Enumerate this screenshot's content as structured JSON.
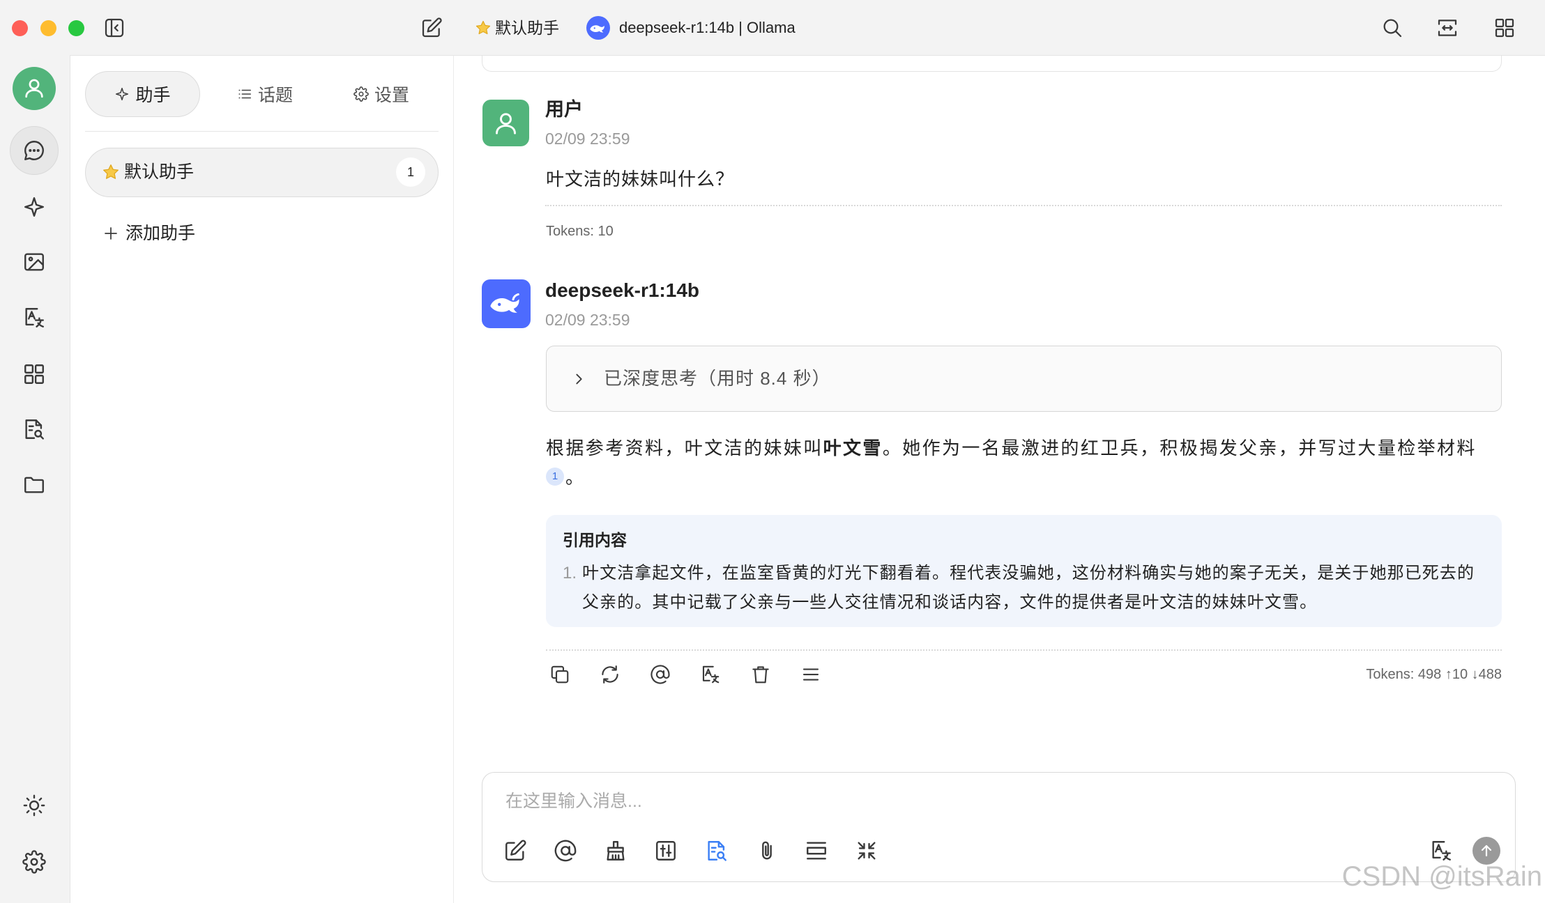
{
  "theme": {
    "user_avatar_color": "#52b47b",
    "deepseek_color": "#4d6bfe",
    "citation_bg": "#f1f5fc",
    "active_icon_color": "#3b7ff5",
    "send_button_color": "#9a9a9a"
  },
  "titlebar": {
    "assistant_name": "默认助手",
    "model": "deepseek-r1:14b | Ollama"
  },
  "sidebar": {
    "tabs": [
      {
        "label": "助手"
      },
      {
        "label": "话题"
      },
      {
        "label": "设置"
      }
    ],
    "assistants": [
      {
        "name": "默认助手",
        "topic_count": "1"
      }
    ],
    "add_assistant": "添加助手"
  },
  "messages": [
    {
      "role": "user",
      "name": "用户",
      "time": "02/09 23:59",
      "text": "叶文洁的妹妹叫什么？",
      "tokens": "Tokens: 10"
    },
    {
      "role": "assistant",
      "name": "deepseek-r1:14b",
      "time": "02/09 23:59",
      "thinking": "已深度思考（用时 8.4 秒）",
      "answer": {
        "before": "根据参考资料，叶文洁的妹妹叫",
        "bold": "叶文雪",
        "after": "。她作为一名最激进的红卫兵，积极揭发父亲，并写过大量检举材料",
        "citation_ref": "1",
        "end": "。"
      },
      "citations": {
        "title": "引用内容",
        "items": [
          {
            "number": "1.",
            "text": "叶文洁拿起文件，在监室昏黄的灯光下翻看着。程代表没骗她，这份材料确实与她的案子无关，是关于她那已死去的父亲的。其中记载了父亲与一些人交往情况和谈话内容，文件的提供者是叶文洁的妹妹叶文雪。"
          }
        ]
      },
      "tokens": "Tokens: 498 ↑10 ↓488"
    }
  ],
  "composer": {
    "placeholder": "在这里输入消息..."
  },
  "watermark": "CSDN @itsRain"
}
